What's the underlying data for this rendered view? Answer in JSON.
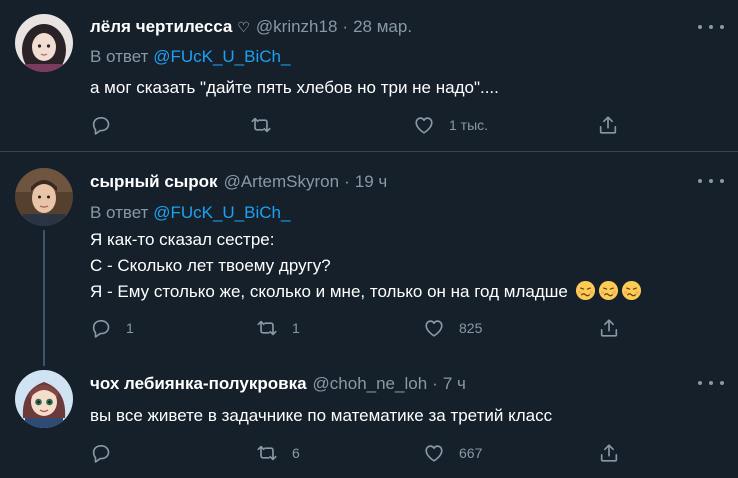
{
  "tweets": [
    {
      "name": "лёля чертилесса",
      "name_suffix": "♡",
      "handle": "@krinzh18",
      "separator": "·",
      "time": "28 мар.",
      "reply_prefix": "В ответ",
      "reply_to": "@FUcK_U_BiCh_",
      "lines": [
        "а мог сказать \"дайте пять хлебов но три не надо\"...."
      ],
      "replies": "",
      "retweets": "",
      "likes": "1 тыс."
    },
    {
      "name": "сырный сырок",
      "handle": "@ArtemSkyron",
      "separator": "·",
      "time": "19 ч",
      "reply_prefix": "В ответ",
      "reply_to": "@FUcK_U_BiCh_",
      "lines": [
        "Я как-то сказал сестре:",
        "С - Сколько лет твоему другу?",
        "Я - Ему столько же, сколько и мне, только он на год младше"
      ],
      "emojis": [
        "woozy-face",
        "woozy-face",
        "woozy-face"
      ],
      "replies": "1",
      "retweets": "1",
      "likes": "825"
    },
    {
      "name": "чох лебиянка-полукровка",
      "handle": "@choh_ne_loh",
      "separator": "·",
      "time": "7 ч",
      "lines": [
        "вы все живете в задачнике по математике за третий класс"
      ],
      "replies": "",
      "retweets": "6",
      "likes": "667"
    }
  ],
  "icons": [
    "reply-icon",
    "retweet-icon",
    "like-icon",
    "share-icon",
    "more-icon"
  ],
  "colors": {
    "background": "#15202b",
    "text": "#ffffff",
    "secondary": "#8899a6",
    "link": "#1da1f2",
    "divider": "#38444d"
  }
}
